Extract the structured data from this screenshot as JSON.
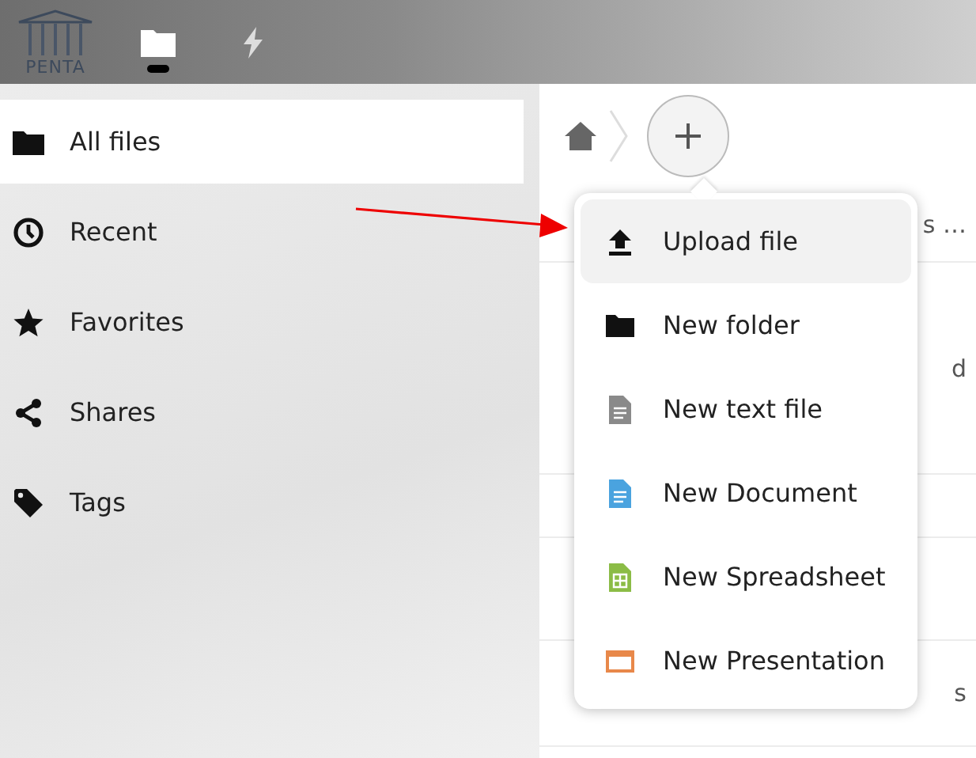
{
  "header": {
    "logo_text": "PENTA",
    "apps": [
      {
        "kind": "files",
        "selected": true
      },
      {
        "kind": "activity",
        "selected": false
      }
    ]
  },
  "sidebar": {
    "items": [
      {
        "kind": "folder",
        "label": "All files",
        "selected": true
      },
      {
        "kind": "clock",
        "label": "Recent",
        "selected": false
      },
      {
        "kind": "star",
        "label": "Favorites",
        "selected": false
      },
      {
        "kind": "share",
        "label": "Shares",
        "selected": false
      },
      {
        "kind": "tag",
        "label": "Tags",
        "selected": false
      }
    ]
  },
  "file_list": {
    "rows": [
      {
        "text": "s …"
      },
      {
        "text": "d"
      },
      {
        "text": ""
      },
      {
        "text": ""
      },
      {
        "text": "s"
      }
    ]
  },
  "new_menu": {
    "items": [
      {
        "kind": "upload",
        "label": "Upload file",
        "selected": true
      },
      {
        "kind": "folder",
        "label": "New folder",
        "selected": false
      },
      {
        "kind": "text",
        "label": "New text file",
        "selected": false
      },
      {
        "kind": "document",
        "label": "New Document",
        "selected": false
      },
      {
        "kind": "spreadsheet",
        "label": "New Spreadsheet",
        "selected": false
      },
      {
        "kind": "presentation",
        "label": "New Presentation",
        "selected": false
      }
    ]
  }
}
